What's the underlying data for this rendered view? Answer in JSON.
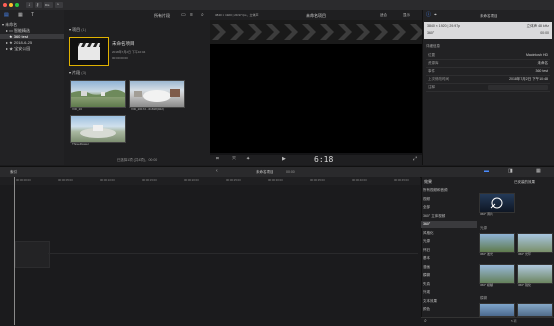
{
  "toolbar": {
    "window_buttons": [
      {
        "name": "close",
        "color": "#ff5f57"
      },
      {
        "name": "minimize",
        "color": "#febc2e"
      },
      {
        "name": "zoom",
        "color": "#28c840"
      }
    ],
    "done_label": "Dis"
  },
  "library": {
    "items": [
      {
        "label": "未命名",
        "level": 0,
        "selected": false
      },
      {
        "label": "智能精选",
        "level": 1,
        "selected": false
      },
      {
        "label": "360 test",
        "level": 1,
        "selected": true
      },
      {
        "label": "2018-6-25",
        "level": 1,
        "selected": false
      },
      {
        "label": "宝安公园",
        "level": 1,
        "selected": false
      }
    ]
  },
  "browser": {
    "filter_label": "所有片段",
    "project_section": "项目",
    "project_count": "(1)",
    "project_name": "未命名项目",
    "project_date": "2018年7月2日 下午10:04",
    "project_duration": "00:00:00:00",
    "clips_section": "片段",
    "clips_count": "(3)",
    "clips": [
      {
        "name": "VID_20"
      },
      {
        "name": "VID_20172...61818(022)"
      },
      {
        "name": "ThreeFlower"
      }
    ],
    "status": "已选择1项 (共4项)，00:00"
  },
  "viewer": {
    "format": "3840 × 1920 | 29.97 fps，立体声",
    "project_title": "未命名项目",
    "view_label": "显示",
    "fit_label": "适合",
    "timecode": "6:18"
  },
  "inspector": {
    "header_title": "未命名项目",
    "format": "3840 × 1920 | 29.97p",
    "audio": "立体声 48 kHz",
    "duration": "00:00",
    "mode": "360°",
    "section": "详细信息",
    "rows": [
      {
        "key": "位置",
        "value": "Macintosh HD"
      },
      {
        "key": "资源库",
        "value": "未命名"
      },
      {
        "key": "事件",
        "value": "360 test"
      },
      {
        "key": "上次修改时间",
        "value": "2018年7月2日 下午10:48"
      },
      {
        "key": "注释",
        "value": ""
      }
    ]
  },
  "timeline": {
    "index_label": "索引",
    "project_name": "未命名项目",
    "timecode": "00:00",
    "ruler_ticks": [
      "00:00:00:00",
      "00:00:05:00",
      "00:00:10:00",
      "00:00:15:00",
      "00:00:20:00",
      "00:00:25:00",
      "00:00:30:00",
      "00:00:35:00",
      "00:00:40:00",
      "00:00:45:00"
    ]
  },
  "effects": {
    "title": "效果",
    "installed_label": "已安装的效果",
    "categories": [
      {
        "label": "所有视频和音频",
        "selected": false
      },
      {
        "label": "视频",
        "selected": false
      },
      {
        "label": "全部",
        "selected": false
      },
      {
        "label": "360° 立体视频",
        "selected": false
      },
      {
        "label": "360°",
        "selected": true
      },
      {
        "label": "风格化",
        "selected": false
      },
      {
        "label": "光源",
        "selected": false
      },
      {
        "label": "怀旧",
        "selected": false
      },
      {
        "label": "基本",
        "selected": false
      },
      {
        "label": "漫画",
        "selected": false
      },
      {
        "label": "模糊",
        "selected": false
      },
      {
        "label": "失真",
        "selected": false
      },
      {
        "label": "外观",
        "selected": false
      },
      {
        "label": "文本效果",
        "selected": false
      },
      {
        "label": "颜色",
        "selected": false
      }
    ],
    "items": [
      {
        "label": "360° 调片",
        "group": ""
      },
      {
        "label": "360° 发光",
        "group": "光源"
      },
      {
        "label": "360° 光环",
        "group": ""
      },
      {
        "label": "360° 模糊",
        "group": ""
      },
      {
        "label": "360° 锐化",
        "group": ""
      }
    ],
    "group_light": "光源",
    "group_blur": "模糊",
    "count_label": "5 项",
    "search_placeholder": "搜索"
  }
}
